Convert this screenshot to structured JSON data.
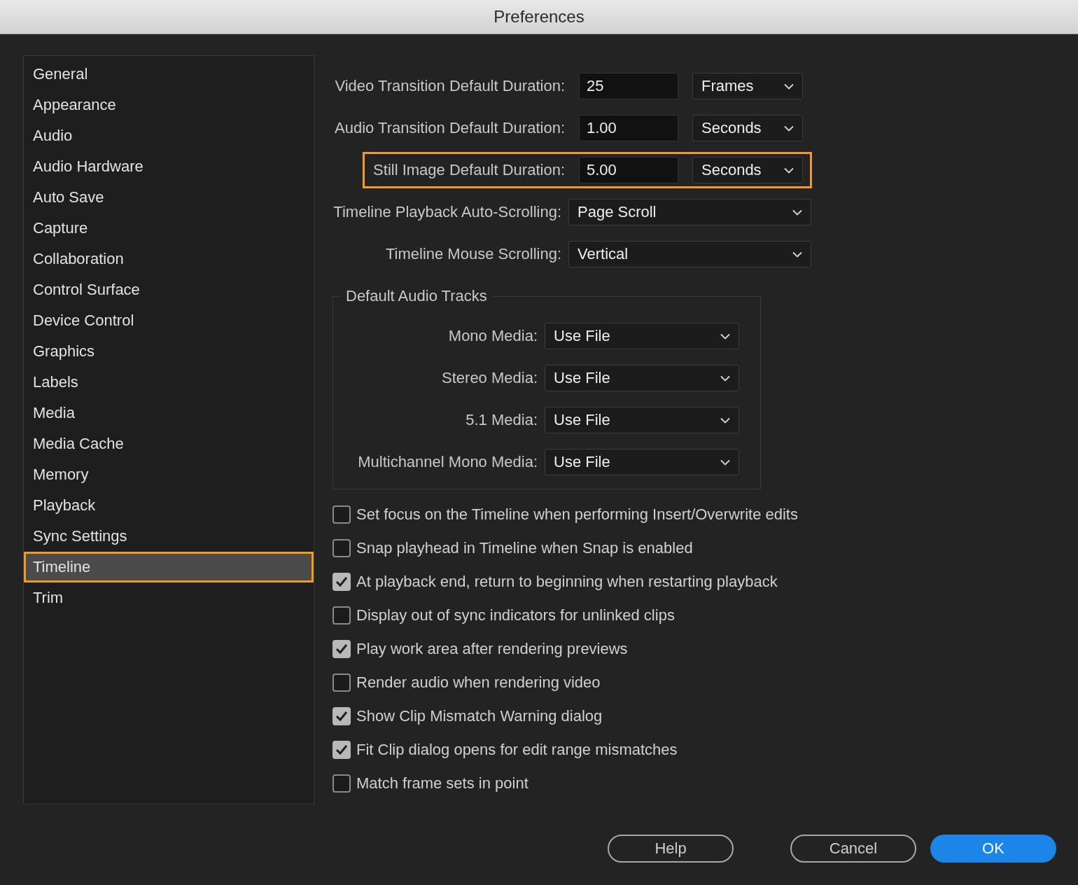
{
  "window": {
    "title": "Preferences"
  },
  "sidebar": {
    "items": [
      {
        "label": "General",
        "selected": false
      },
      {
        "label": "Appearance",
        "selected": false
      },
      {
        "label": "Audio",
        "selected": false
      },
      {
        "label": "Audio Hardware",
        "selected": false
      },
      {
        "label": "Auto Save",
        "selected": false
      },
      {
        "label": "Capture",
        "selected": false
      },
      {
        "label": "Collaboration",
        "selected": false
      },
      {
        "label": "Control Surface",
        "selected": false
      },
      {
        "label": "Device Control",
        "selected": false
      },
      {
        "label": "Graphics",
        "selected": false
      },
      {
        "label": "Labels",
        "selected": false
      },
      {
        "label": "Media",
        "selected": false
      },
      {
        "label": "Media Cache",
        "selected": false
      },
      {
        "label": "Memory",
        "selected": false
      },
      {
        "label": "Playback",
        "selected": false
      },
      {
        "label": "Sync Settings",
        "selected": false
      },
      {
        "label": "Timeline",
        "selected": true
      },
      {
        "label": "Trim",
        "selected": false
      }
    ]
  },
  "settings": [
    {
      "kind": "duration",
      "label": "Video Transition Default Duration:",
      "value": "25",
      "unit": "Frames",
      "highlighted": false
    },
    {
      "kind": "duration",
      "label": "Audio Transition Default Duration:",
      "value": "1.00",
      "unit": "Seconds",
      "highlighted": false
    },
    {
      "kind": "duration",
      "label": "Still Image Default Duration:",
      "value": "5.00",
      "unit": "Seconds",
      "highlighted": true
    },
    {
      "kind": "choice",
      "label": "Timeline Playback Auto-Scrolling:",
      "value": "Page Scroll",
      "highlighted": false
    },
    {
      "kind": "choice",
      "label": "Timeline Mouse Scrolling:",
      "value": "Vertical",
      "highlighted": false
    }
  ],
  "default_audio_tracks": {
    "title": "Default Audio Tracks",
    "rows": [
      {
        "label": "Mono Media:",
        "value": "Use File"
      },
      {
        "label": "Stereo Media:",
        "value": "Use File"
      },
      {
        "label": "5.1 Media:",
        "value": "Use File"
      },
      {
        "label": "Multichannel Mono Media:",
        "value": "Use File"
      }
    ]
  },
  "options": [
    {
      "label": "Set focus on the Timeline when performing Insert/Overwrite edits",
      "checked": false
    },
    {
      "label": "Snap playhead in Timeline when Snap is enabled",
      "checked": false
    },
    {
      "label": "At playback end, return to beginning when restarting playback",
      "checked": true
    },
    {
      "label": "Display out of sync indicators for unlinked clips",
      "checked": false
    },
    {
      "label": "Play work area after rendering previews",
      "checked": true
    },
    {
      "label": "Render audio when rendering video",
      "checked": false
    },
    {
      "label": "Show Clip Mismatch Warning dialog",
      "checked": true
    },
    {
      "label": "Fit Clip dialog opens for edit range mismatches",
      "checked": true
    },
    {
      "label": "Match frame sets in point",
      "checked": false
    }
  ],
  "buttons": [
    {
      "label": "Help",
      "kind": "secondary"
    },
    {
      "label": "Cancel",
      "kind": "secondary"
    },
    {
      "label": "OK",
      "kind": "primary"
    }
  ]
}
